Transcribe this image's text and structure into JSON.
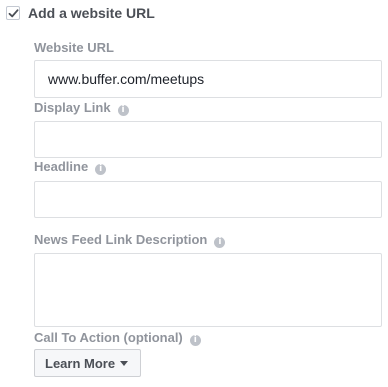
{
  "website_url_toggle": {
    "label": "Add a website URL",
    "checked": true
  },
  "fields": {
    "website_url": {
      "label": "Website URL",
      "value": "www.buffer.com/meetups"
    },
    "display_link": {
      "label": "Display Link",
      "value": "",
      "info_icon": "info-icon"
    },
    "headline": {
      "label": "Headline",
      "value": "",
      "info_icon": "info-icon"
    },
    "news_feed_link_description": {
      "label": "News Feed Link Description",
      "value": "",
      "info_icon": "info-icon"
    },
    "call_to_action": {
      "label": "Call To Action (optional)",
      "info_icon": "info-icon",
      "selected": "Learn More"
    }
  },
  "colors": {
    "label_gray": "#90949c",
    "text_dark": "#4b4f56",
    "border": "#dddfe2",
    "checkmark": "#4b4f56"
  }
}
